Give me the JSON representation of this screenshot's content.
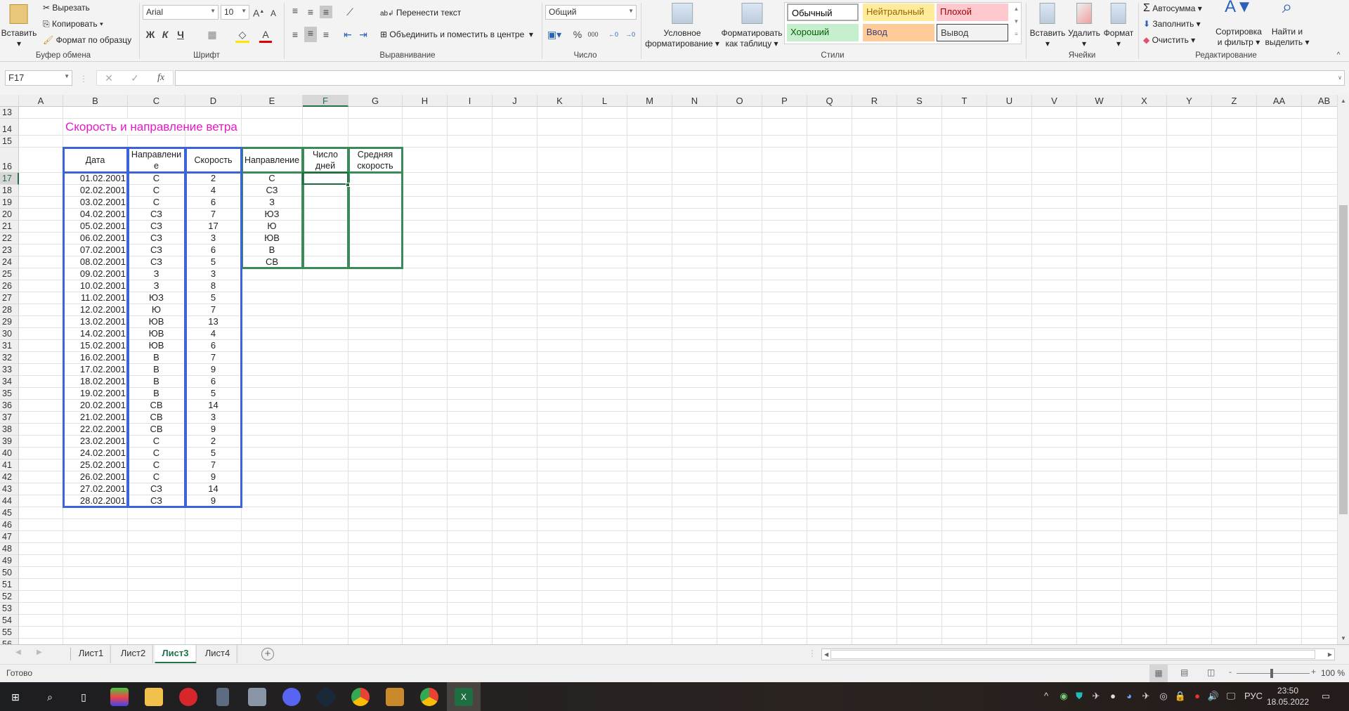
{
  "ribbon": {
    "clipboard": {
      "paste": "Вставить",
      "cut": "Вырезать",
      "copy": "Копировать",
      "format_painter": "Формат по образцу",
      "label": "Буфер обмена"
    },
    "font": {
      "name": "Arial",
      "size": "10",
      "bold": "Ж",
      "italic": "К",
      "underline": "Ч",
      "label": "Шрифт"
    },
    "alignment": {
      "wrap": "Перенести текст",
      "merge": "Объединить и поместить в центре",
      "label": "Выравнивание"
    },
    "number": {
      "format": "Общий",
      "percent": "%",
      "thousands": "000",
      "label": "Число"
    },
    "styles": {
      "conditional": [
        "Условное",
        "форматирование ▾"
      ],
      "as_table": [
        "Форматировать",
        "как таблицу ▾"
      ],
      "gallery": [
        {
          "label": "Обычный",
          "bg": "#ffffff",
          "fg": "#000000"
        },
        {
          "label": "Нейтральный",
          "bg": "#ffeb9c",
          "fg": "#9c6500"
        },
        {
          "label": "Плохой",
          "bg": "#ffc7ce",
          "fg": "#9c0006"
        },
        {
          "label": "Хороший",
          "bg": "#c6efce",
          "fg": "#006100"
        },
        {
          "label": "Ввод",
          "bg": "#ffcc99",
          "fg": "#3f3f76"
        },
        {
          "label": "Вывод",
          "bg": "#f2f2f2",
          "fg": "#3f3f3f"
        }
      ],
      "label": "Стили"
    },
    "cells": {
      "insert": "Вставить",
      "delete": "Удалить",
      "format": "Формат",
      "label": "Ячейки"
    },
    "editing": {
      "autosum": "Автосумма",
      "fill": "Заполнить",
      "clear": "Очистить",
      "sort": [
        "Сортировка",
        "и фильтр ▾"
      ],
      "find": [
        "Найти и",
        "выделить ▾"
      ],
      "label": "Редактирование"
    }
  },
  "formula_bar": {
    "name_box": "F17",
    "cancel": "✕",
    "enter": "✓",
    "fx": "fx",
    "value": ""
  },
  "sheet": {
    "columns": [
      "A",
      "B",
      "C",
      "D",
      "E",
      "F",
      "G",
      "H",
      "I",
      "J",
      "K",
      "L",
      "M",
      "N",
      "O",
      "P",
      "Q",
      "R",
      "S",
      "T",
      "U",
      "V",
      "W",
      "X",
      "Y",
      "Z",
      "AA",
      "AB"
    ],
    "first_row": 13,
    "last_row": 56,
    "selected_cell": "F17",
    "title": "Скорость и направление ветра",
    "title_color": "#e619c9",
    "table1_border_color": "#3c64d8",
    "table2_border_color": "#3a8a5a",
    "table1_headers": [
      "Дата",
      "Направлени е",
      "Скорость"
    ],
    "table1_rows": [
      [
        "01.02.2001",
        "С",
        "2"
      ],
      [
        "02.02.2001",
        "С",
        "4"
      ],
      [
        "03.02.2001",
        "С",
        "6"
      ],
      [
        "04.02.2001",
        "СЗ",
        "7"
      ],
      [
        "05.02.2001",
        "СЗ",
        "17"
      ],
      [
        "06.02.2001",
        "СЗ",
        "3"
      ],
      [
        "07.02.2001",
        "СЗ",
        "6"
      ],
      [
        "08.02.2001",
        "СЗ",
        "5"
      ],
      [
        "09.02.2001",
        "З",
        "3"
      ],
      [
        "10.02.2001",
        "З",
        "8"
      ],
      [
        "11.02.2001",
        "ЮЗ",
        "5"
      ],
      [
        "12.02.2001",
        "Ю",
        "7"
      ],
      [
        "13.02.2001",
        "ЮВ",
        "13"
      ],
      [
        "14.02.2001",
        "ЮВ",
        "4"
      ],
      [
        "15.02.2001",
        "ЮВ",
        "6"
      ],
      [
        "16.02.2001",
        "В",
        "7"
      ],
      [
        "17.02.2001",
        "В",
        "9"
      ],
      [
        "18.02.2001",
        "В",
        "6"
      ],
      [
        "19.02.2001",
        "В",
        "5"
      ],
      [
        "20.02.2001",
        "СВ",
        "14"
      ],
      [
        "21.02.2001",
        "СВ",
        "3"
      ],
      [
        "22.02.2001",
        "СВ",
        "9"
      ],
      [
        "23.02.2001",
        "С",
        "2"
      ],
      [
        "24.02.2001",
        "С",
        "5"
      ],
      [
        "25.02.2001",
        "С",
        "7"
      ],
      [
        "26.02.2001",
        "С",
        "9"
      ],
      [
        "27.02.2001",
        "СЗ",
        "14"
      ],
      [
        "28.02.2001",
        "СЗ",
        "9"
      ]
    ],
    "table2_headers": [
      "Направление",
      "Число дней",
      "Средняя скорость"
    ],
    "table2_directions": [
      "С",
      "СЗ",
      "З",
      "ЮЗ",
      "Ю",
      "ЮВ",
      "В",
      "СВ"
    ]
  },
  "tabs": {
    "items": [
      "Лист1",
      "Лист2",
      "Лист3",
      "Лист4"
    ],
    "active": 2,
    "add": "+"
  },
  "status": {
    "text": "Готово",
    "zoom": "100 %"
  },
  "taskbar": {
    "lang": "РУС",
    "time": "23:50",
    "date": "18.05.2022"
  }
}
